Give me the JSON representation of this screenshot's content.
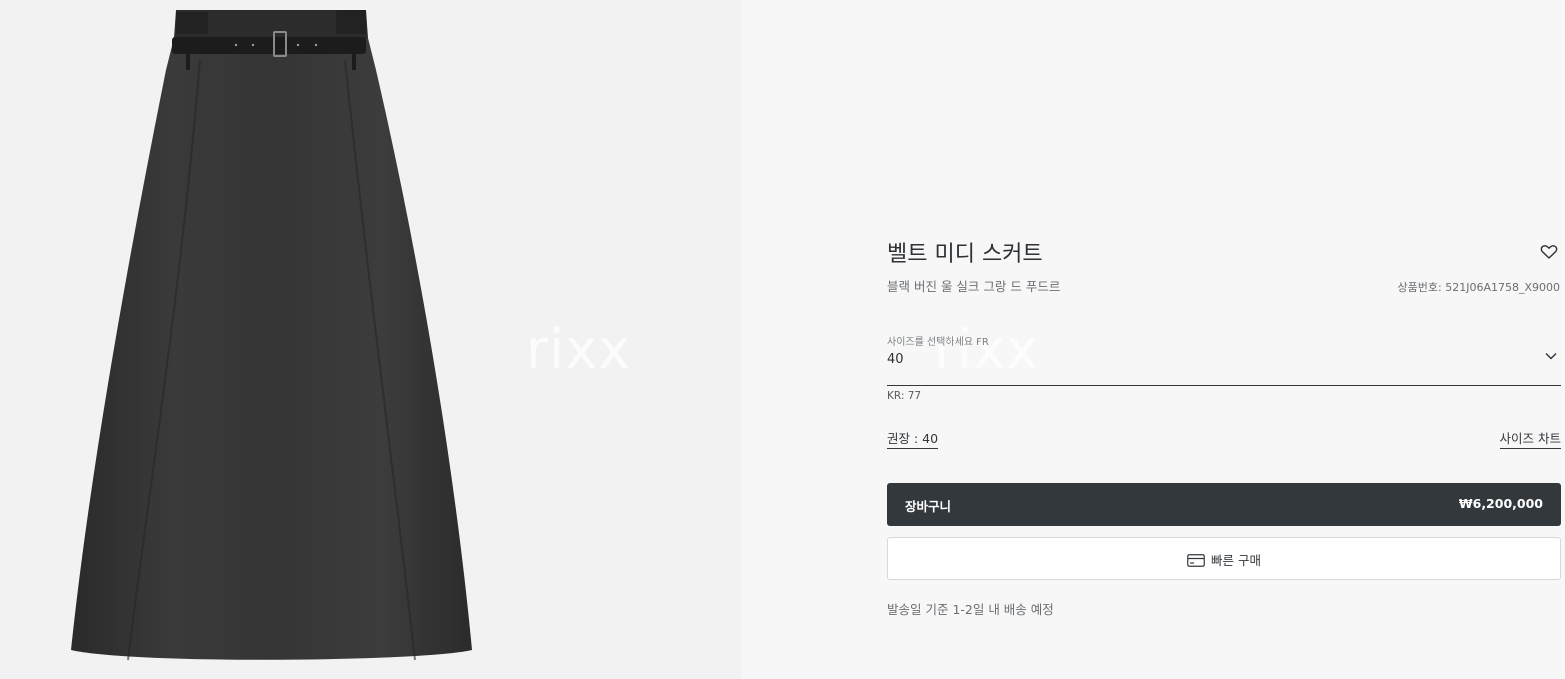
{
  "product": {
    "title": "벨트 미디 스커트",
    "subtitle": "블랙 버진 울 실크 그랑 드 푸드르",
    "sku": "상품번호: 521J06A1758_X9000",
    "image_alt": "black belted midi skirt"
  },
  "watermark": {
    "text_left": "rixx",
    "text_right": "rixx"
  },
  "size_selector": {
    "hint": "사이즈를 선택하세요 FR",
    "value": "40",
    "kr_size": "KR: 77",
    "recommended": "권장 : 40",
    "size_chart_link": "사이즈 차트"
  },
  "actions": {
    "cart_label": "장바구니",
    "cart_price": "₩6,200,000",
    "quick_buy_label": "빠른 구매"
  },
  "delivery_note": "발송일 기준 1-2일 내 배송 예정",
  "icons": {
    "wishlist": "heart-icon",
    "dropdown": "chevron-down-icon",
    "quick_buy": "credit-card-icon"
  },
  "colors": {
    "primary_button": "#33383c",
    "panel_background": "#f7f7f7",
    "image_background": "#f2f2f2"
  }
}
